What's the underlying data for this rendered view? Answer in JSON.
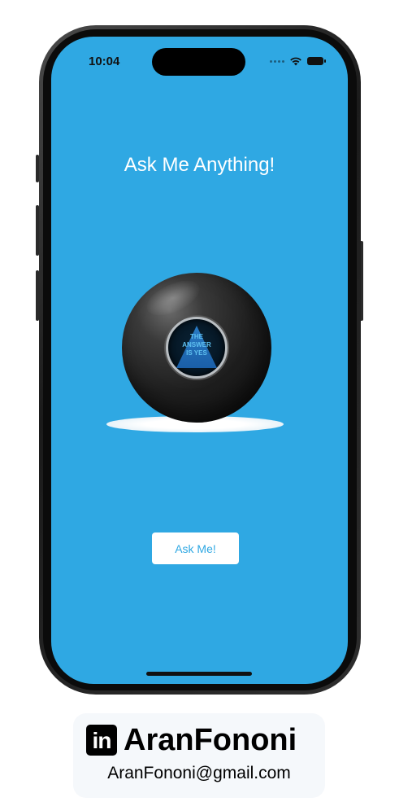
{
  "status_bar": {
    "time": "10:04",
    "icons": [
      "cellular-dots-icon",
      "wifi-icon",
      "battery-icon"
    ]
  },
  "app": {
    "title": "Ask Me Anything!",
    "ball": {
      "answer_line1": "THE",
      "answer_line2": "ANSWER",
      "answer_line3": "IS YES"
    },
    "ask_button_label": "Ask Me!"
  },
  "footer": {
    "logo_text": "in",
    "name": "AranFononi",
    "email": "AranFononi@gmail.com"
  },
  "colors": {
    "screen_background": "#2fa8e3",
    "button_text": "#2fa8e3",
    "title_text": "#ffffff"
  }
}
